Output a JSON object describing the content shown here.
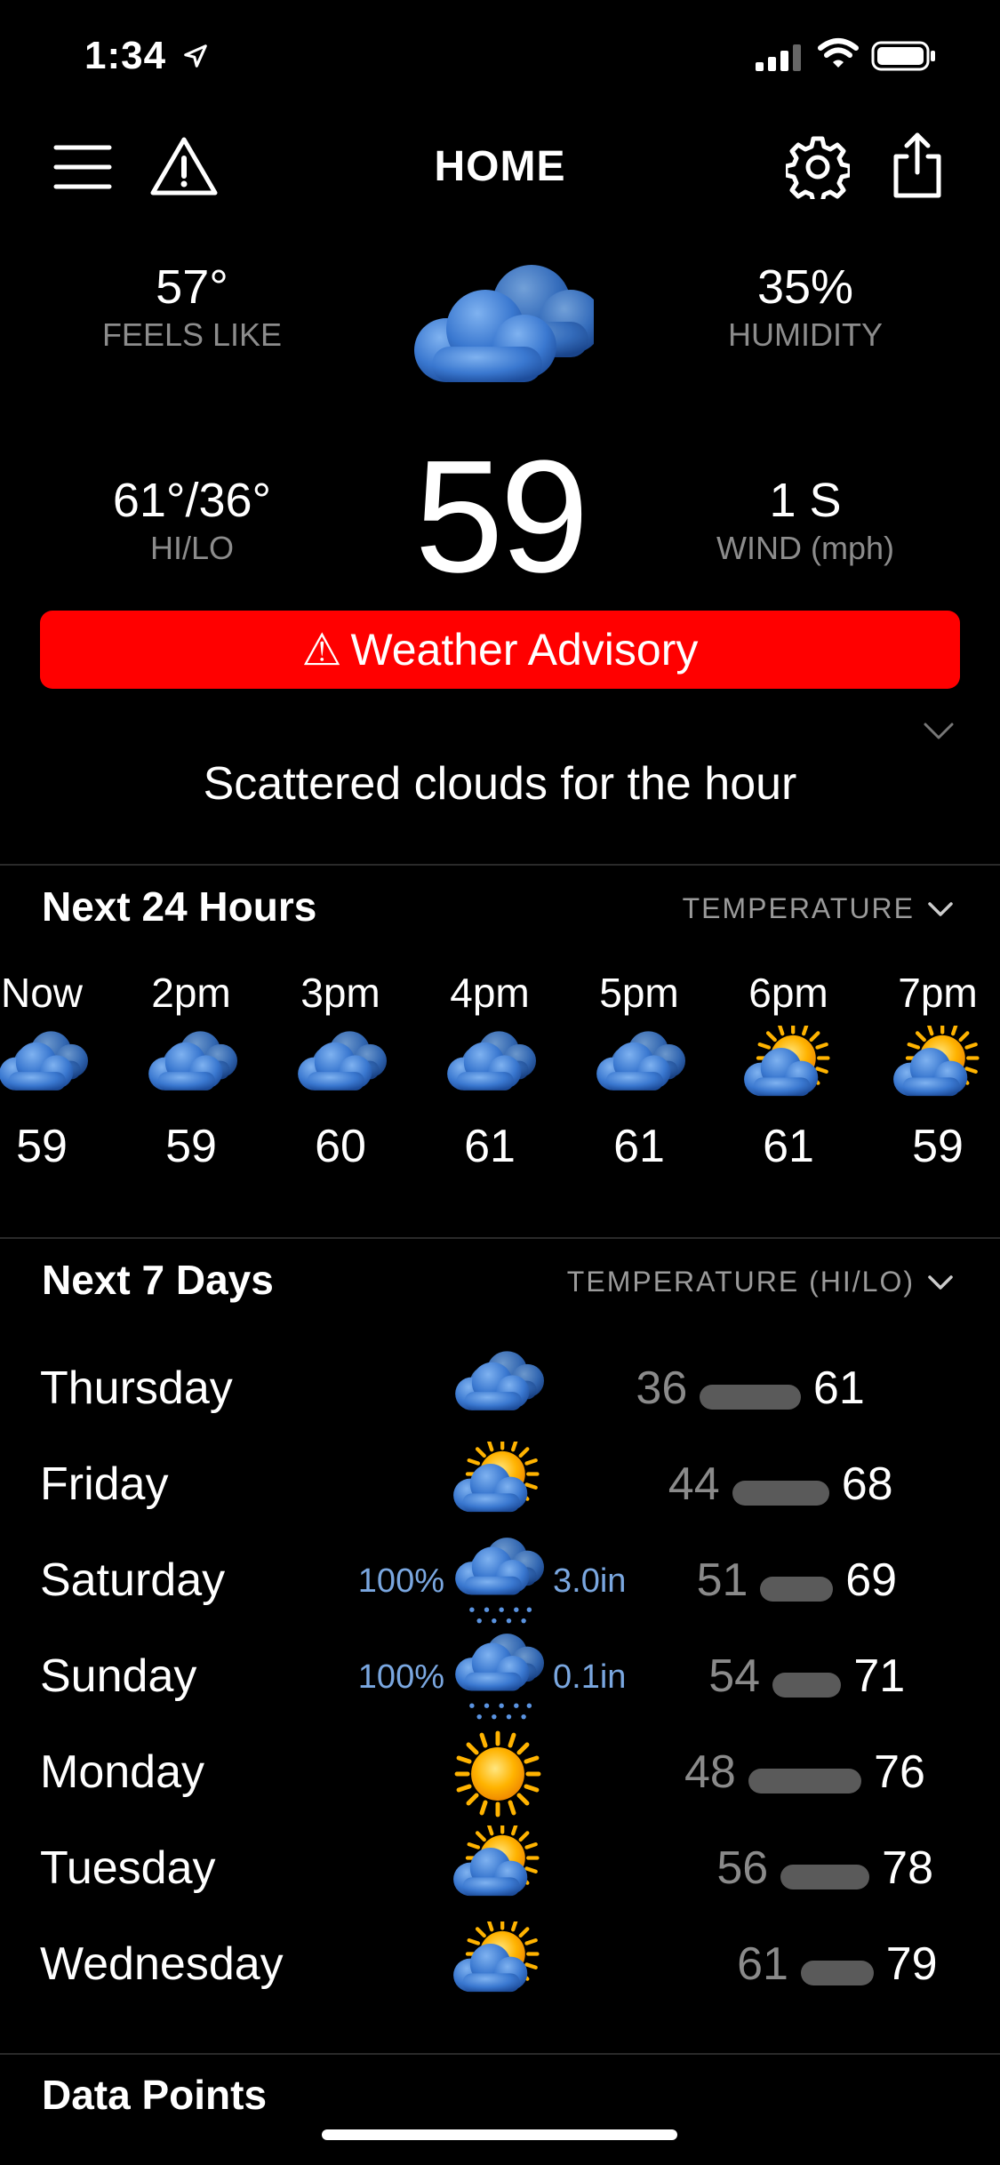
{
  "status_bar": {
    "time": "1:34"
  },
  "header": {
    "title": "HOME"
  },
  "current": {
    "feels_like_value": "57°",
    "feels_like_label": "FEELS LIKE",
    "humidity_value": "35%",
    "humidity_label": "HUMIDITY",
    "hilo_value": "61°/36°",
    "hilo_label": "HI/LO",
    "wind_value": "1 S",
    "wind_label": "WIND (mph)",
    "temperature": "59",
    "icon": "cloudy-icon"
  },
  "advisory": {
    "symbol": "⚠",
    "label": "Weather Advisory"
  },
  "summary": "Scattered clouds for the hour",
  "hourly": {
    "title": "Next 24 Hours",
    "dropdown": "TEMPERATURE",
    "items": [
      {
        "time": "Now",
        "temp": "59",
        "icon": "cloudy-icon"
      },
      {
        "time": "2pm",
        "temp": "59",
        "icon": "cloudy-icon"
      },
      {
        "time": "3pm",
        "temp": "60",
        "icon": "cloudy-icon"
      },
      {
        "time": "4pm",
        "temp": "61",
        "icon": "cloudy-icon"
      },
      {
        "time": "5pm",
        "temp": "61",
        "icon": "cloudy-icon"
      },
      {
        "time": "6pm",
        "temp": "61",
        "icon": "partly-cloudy-icon"
      },
      {
        "time": "7pm",
        "temp": "59",
        "icon": "partly-cloudy-icon"
      }
    ]
  },
  "daily": {
    "title": "Next 7 Days",
    "dropdown": "TEMPERATURE (HI/LO)",
    "items": [
      {
        "day": "Thursday",
        "icon": "cloudy-icon",
        "precip_pct": "",
        "precip_amt": "",
        "lo": "36",
        "hi": "61"
      },
      {
        "day": "Friday",
        "icon": "partly-cloudy-icon",
        "precip_pct": "",
        "precip_amt": "",
        "lo": "44",
        "hi": "68"
      },
      {
        "day": "Saturday",
        "icon": "rain-icon",
        "precip_pct": "100%",
        "precip_amt": "3.0in",
        "lo": "51",
        "hi": "69"
      },
      {
        "day": "Sunday",
        "icon": "rain-icon",
        "precip_pct": "100%",
        "precip_amt": "0.1in",
        "lo": "54",
        "hi": "71"
      },
      {
        "day": "Monday",
        "icon": "sun-icon",
        "precip_pct": "",
        "precip_amt": "",
        "lo": "48",
        "hi": "76"
      },
      {
        "day": "Tuesday",
        "icon": "partly-cloudy-icon",
        "precip_pct": "",
        "precip_amt": "",
        "lo": "56",
        "hi": "78"
      },
      {
        "day": "Wednesday",
        "icon": "partly-cloudy-icon",
        "precip_pct": "",
        "precip_amt": "",
        "lo": "61",
        "hi": "79"
      }
    ]
  },
  "data_points": {
    "title": "Data Points"
  },
  "colors": {
    "advisory": "#ff0000",
    "precip": "#7aa7e0",
    "background": "#000000"
  }
}
